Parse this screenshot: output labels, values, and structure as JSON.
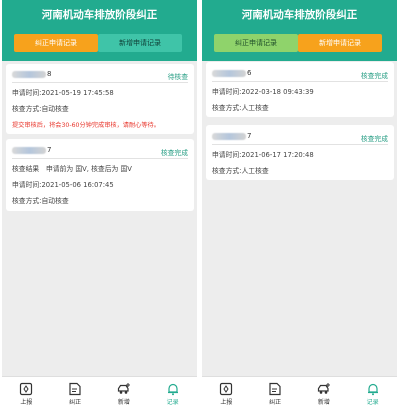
{
  "colors": {
    "header": "#22ab8f",
    "accent": "#f7a21c",
    "status": "#2a9f86",
    "warning": "#e8352b"
  },
  "left": {
    "title": "河南机动车排放阶段纠正",
    "tabs": [
      {
        "label": "纠正申请记录"
      },
      {
        "label": "新增申请记录"
      }
    ],
    "records": [
      {
        "plate_tail": "8",
        "status": "待核查",
        "apply_time": "申请时间:2021-05-19 17:45:58",
        "method": "核查方式:自动核查",
        "note": "提交审核后，将会30-60分钟完成审核，请耐心等待。"
      },
      {
        "plate_tail": "7",
        "status": "核查完成",
        "result": "核查结果　申请前为 国V, 核查后为 国V",
        "apply_time": "申请时间:2021-05-06 16:07:45",
        "method": "核查方式:自动核查"
      }
    ],
    "nav": [
      {
        "label": "上报",
        "icon": "report-icon"
      },
      {
        "label": "纠正",
        "icon": "correct-icon"
      },
      {
        "label": "新增",
        "icon": "car-add-icon"
      },
      {
        "label": "记录",
        "icon": "bell-icon"
      }
    ]
  },
  "right": {
    "title": "河南机动车排放阶段纠正",
    "tabs": [
      {
        "label": "纠正申请记录"
      },
      {
        "label": "新增申请记录"
      }
    ],
    "records": [
      {
        "plate_tail": "6",
        "status": "核查完成",
        "apply_time": "申请时间:2022-03-18 09:43:39",
        "method": "核查方式:人工核查"
      },
      {
        "plate_tail": "7",
        "status": "核查完成",
        "apply_time": "申请时间:2021-06-17 17:20:48",
        "method": "核查方式:人工核查"
      }
    ],
    "nav": [
      {
        "label": "上报",
        "icon": "report-icon"
      },
      {
        "label": "纠正",
        "icon": "correct-icon"
      },
      {
        "label": "新增",
        "icon": "car-add-icon"
      },
      {
        "label": "记录",
        "icon": "bell-icon"
      }
    ]
  }
}
